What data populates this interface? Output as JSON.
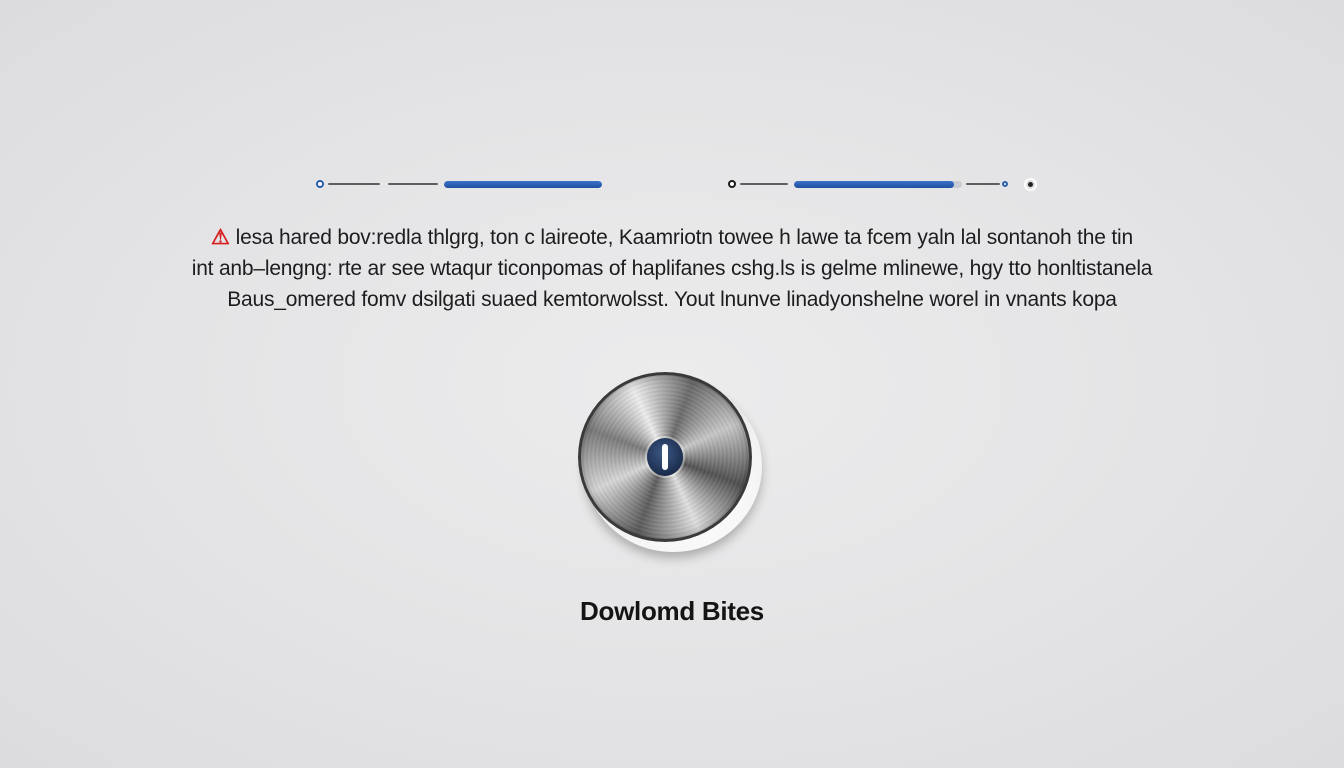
{
  "progress": {
    "left_fraction": 1.0,
    "right_fraction": 0.95
  },
  "message": {
    "alert_icon": "alert-icon",
    "line1": "lesa hared bov:redla thlgrg, ton c laireote, Kaamriotn towee h lawe ta fcem yaln lal sontanoh the tin",
    "line2": "int anb–lengng: rte ar see wtaqur ticonpomas of haplifanes cshg.ls is gelme mlinewe, hgy tto honltistanela",
    "line3": "Baus_omered fomv dsilgati suaed kemtorwolsst. Yout lnunve linadyonshelne worel in vnants kopa"
  },
  "knob": {
    "icon": "power-knob-icon"
  },
  "caption": "Dowlomd Bites",
  "colors": {
    "accent": "#2b5fa8",
    "alert": "#d62020",
    "background": "#e3e3e5",
    "text": "#1d1d1f"
  }
}
